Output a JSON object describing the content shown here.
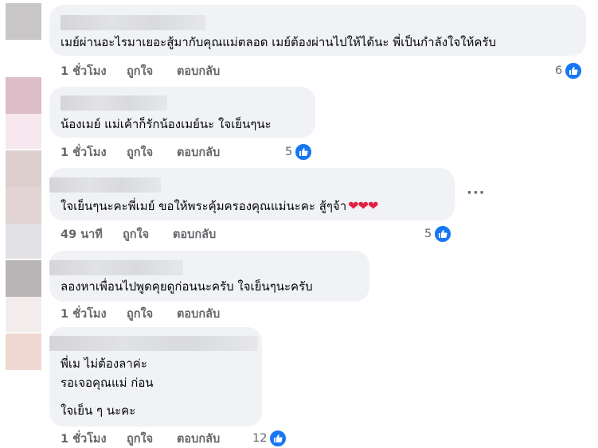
{
  "comments": [
    {
      "text_lines": [
        "เมย์ผ่านอะไรมาเยอะสู้มากับคุณแม่ตลอด เมย์ต้องผ่านไปให้ได้นะ พี่เป็นกำลังใจให้ครับ"
      ],
      "time": "1 ชั่วโมง",
      "like": "ถูกใจ",
      "reply": "ตอบกลับ",
      "reactions": "6"
    },
    {
      "text_lines": [
        "น้องเมย์ แม่เค้าก็รักน้องเมย์นะ ใจเย็นๆนะ"
      ],
      "time": "1 ชั่วโมง",
      "like": "ถูกใจ",
      "reply": "ตอบกลับ",
      "reactions": "5"
    },
    {
      "text_lines": [
        "ใจเย็นๆนะคะพี่เมย์ ขอให้พระคุ้มครองคุณแม่นะคะ สู้ๆจ้า"
      ],
      "hearts": "❤❤❤",
      "more": "···",
      "time": "49 นาที",
      "like": "ถูกใจ",
      "reply": "ตอบกลับ",
      "reactions": "5"
    },
    {
      "text_lines": [
        "ลองหาเพื่อนไปพูดคุยดูก่อนนะครับ ใจเย็นๆนะครับ"
      ],
      "time": "1 ชั่วโมง",
      "like": "ถูกใจ",
      "reply": "ตอบกลับ"
    },
    {
      "text_lines": [
        "พี่เม ไม่ต้องลาค่ะ",
        "รอเจอคุณแม่ ก่อน",
        "ใจเย็น ๆ นะคะ"
      ],
      "time": "1 ชั่วโมง",
      "like": "ถูกใจ",
      "reply": "ตอบกลับ",
      "reactions": "12"
    }
  ],
  "icons": {
    "reaction": "like-thumb-icon",
    "more": "more-horizontal-icon"
  },
  "colors": {
    "bubble": "#f0f2f5",
    "meta": "#65676b",
    "like_blue": "#1877f2",
    "heart": "#e41e3f"
  }
}
